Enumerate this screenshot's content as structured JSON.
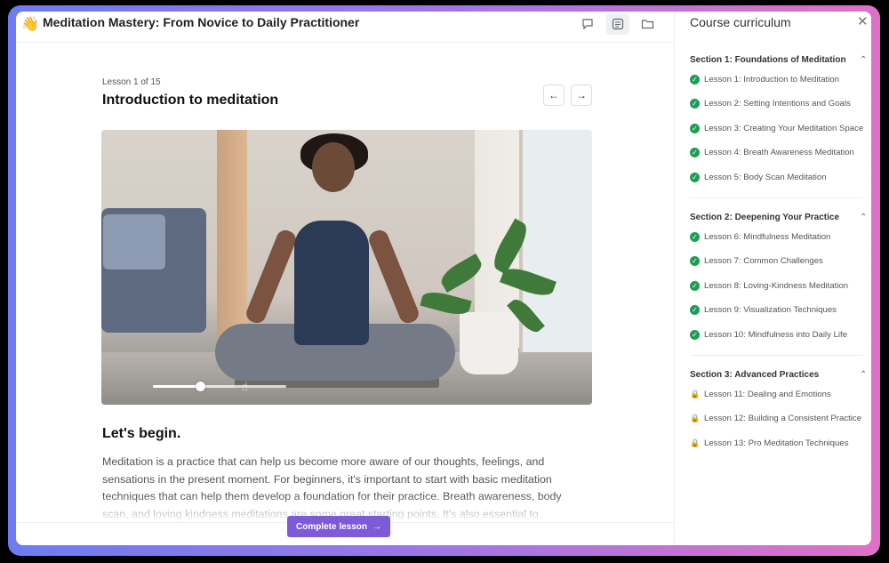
{
  "header": {
    "title": "Meditation Mastery: From Novice to Daily Practitioner",
    "logo_icon": "waving-hand-icon",
    "buttons": [
      "chat-icon",
      "list-icon",
      "folder-icon"
    ]
  },
  "lesson": {
    "count": "Lesson 1 of 15",
    "title": "Introduction to meditation",
    "video_progress": 0.35,
    "heading": "Let's begin.",
    "body": "Meditation is a practice that can help us become more aware of our thoughts, feelings, and sensations in the present moment. For beginners, it's important to start with basic meditation techniques that can help them develop a foundation for their practice. Breath awareness, body scan, and loving kindness meditations are some great starting points. It's also essential to"
  },
  "footer": {
    "complete_label": "Complete lesson",
    "complete_arrow": "→"
  },
  "sidebar": {
    "title": "Course curriculum",
    "sections": [
      {
        "title": "Section 1: Foundations of Meditation",
        "lessons": [
          {
            "label": "Lesson 1: Introduction to Meditation",
            "status": "complete"
          },
          {
            "label": "Lesson 2: Setting Intentions and Goals",
            "status": "complete"
          },
          {
            "label": "Lesson 3: Creating Your Meditation Space",
            "status": "complete"
          },
          {
            "label": "Lesson 4: Breath Awareness Meditation",
            "status": "complete"
          },
          {
            "label": "Lesson 5: Body Scan Meditation",
            "status": "complete"
          }
        ]
      },
      {
        "title": "Section 2: Deepening Your Practice",
        "lessons": [
          {
            "label": "Lesson 6: Mindfulness Meditation",
            "status": "complete"
          },
          {
            "label": "Lesson 7: Common Challenges",
            "status": "complete"
          },
          {
            "label": "Lesson 8: Loving-Kindness Meditation",
            "status": "complete"
          },
          {
            "label": "Lesson 9: Visualization Techniques",
            "status": "complete"
          },
          {
            "label": "Lesson 10: Mindfulness into Daily Life",
            "status": "complete"
          }
        ]
      },
      {
        "title": "Section 3: Advanced Practices",
        "lessons": [
          {
            "label": "Lesson 11: Dealing and Emotions",
            "status": "locked"
          },
          {
            "label": "Lesson 12: Building a Consistent Practice",
            "status": "locked"
          },
          {
            "label": "Lesson 13: Pro Meditation Techniques",
            "status": "locked"
          }
        ]
      }
    ]
  },
  "colors": {
    "accent": "#7e5bd6",
    "complete": "#1f9d55"
  }
}
